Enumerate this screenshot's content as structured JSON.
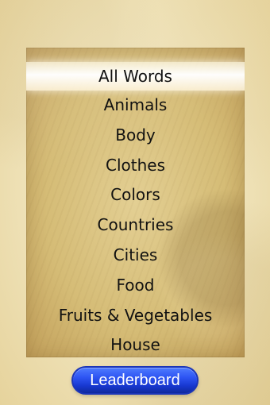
{
  "menu": {
    "items": [
      "All Words",
      "Animals",
      "Body",
      "Clothes",
      "Colors",
      "Countries",
      "Cities",
      "Food",
      "Fruits & Vegetables",
      "House"
    ],
    "selected_index": 0
  },
  "footer": {
    "leaderboard_label": "Leaderboard"
  },
  "colors": {
    "selected_highlight": "#fffaf0",
    "button_blue": "#2e55f3",
    "paper_background": "#f1e6c2",
    "panel_background": "#d5bc76"
  }
}
